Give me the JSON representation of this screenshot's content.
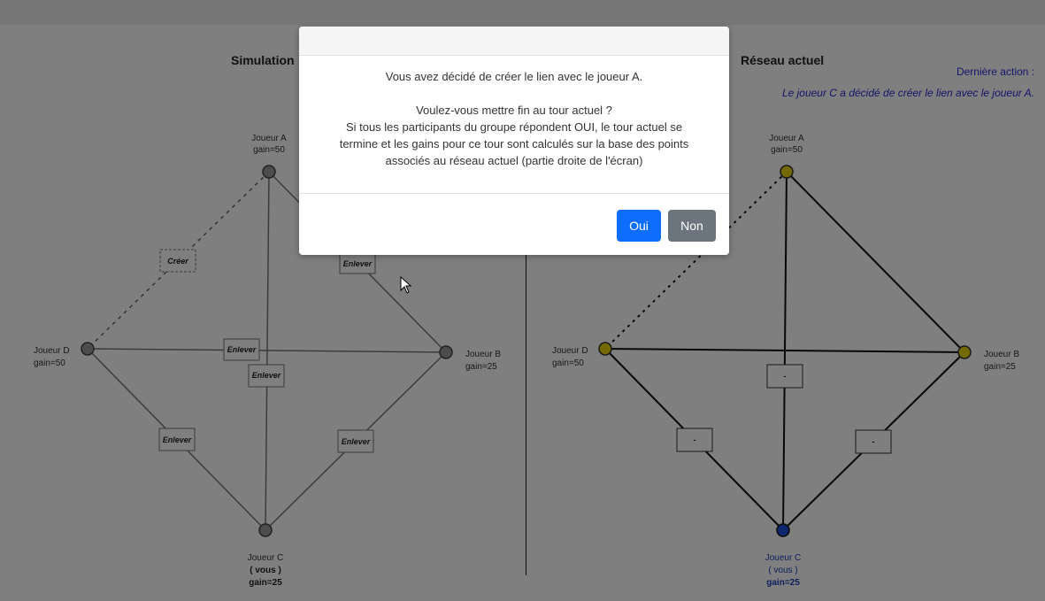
{
  "left": {
    "title": "Simulation",
    "create_label": "Créer",
    "remove_label": "Enlever"
  },
  "right": {
    "title": "Réseau actuel",
    "last_action_label": "Dernière action :",
    "last_action_text": "Le joueur C a décidé de créer le lien avec le joueur A.",
    "edge_placeholder": "-"
  },
  "players": {
    "A": {
      "name": "Joueur A",
      "gain": "gain=50"
    },
    "B": {
      "name": "Joueur B",
      "gain": "gain=25"
    },
    "C": {
      "name": "Joueur C",
      "you": "( vous )",
      "gain": "gain=25"
    },
    "D": {
      "name": "Joueur D",
      "gain": "gain=50"
    }
  },
  "modal": {
    "line1": "Vous avez décidé de créer le lien avec le joueur A.",
    "line2": "Voulez-vous mettre fin au tour actuel ?",
    "line3": "Si tous les participants du groupe répondent OUI, le tour actuel se",
    "line4": "termine et les gains pour ce tour sont calculés sur la base des points",
    "line5": "associés au réseau actuel (partie droite de l'écran)",
    "yes": "Oui",
    "no": "Non"
  },
  "colors": {
    "node_grey": "#9a9a9a",
    "node_yellow": "#c9b800",
    "node_blue": "#1c4fd8",
    "accent": "#0d6efd"
  }
}
